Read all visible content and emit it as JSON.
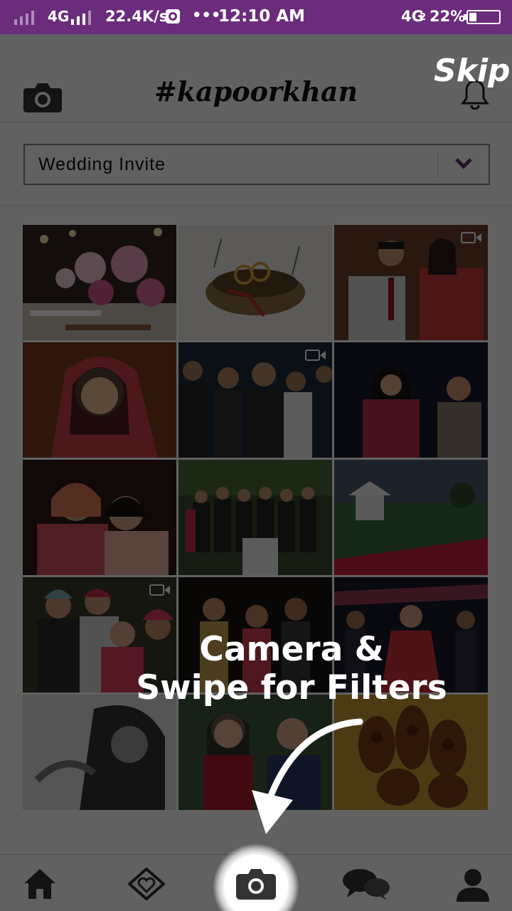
{
  "status_bar": {
    "network": "4G",
    "speed": "22.4K/s",
    "dots": "•••",
    "time": "12:10 AM",
    "network2": "4G",
    "network2_sub": "2",
    "battery": "22%"
  },
  "header": {
    "brand": "#kapoorkhan",
    "camera_icon": "camera-icon",
    "bell_icon": "bell-icon"
  },
  "album_select": {
    "selected": "Wedding Invite",
    "chevron_icon": "chevron-down-icon",
    "accent": "#6b2c7c"
  },
  "gallery": {
    "tiles": [
      {
        "subject": "floral table decor",
        "video": false
      },
      {
        "subject": "rings in nest",
        "video": false
      },
      {
        "subject": "couple seated",
        "video": true
      },
      {
        "subject": "bride portrait",
        "video": false
      },
      {
        "subject": "dance party",
        "video": true
      },
      {
        "subject": "bride dancing",
        "video": false
      },
      {
        "subject": "bride kiss",
        "video": false
      },
      {
        "subject": "group photo",
        "video": false
      },
      {
        "subject": "outdoor venue",
        "video": false
      },
      {
        "subject": "turban family",
        "video": true
      },
      {
        "subject": "night party",
        "video": false
      },
      {
        "subject": "ceremony",
        "video": false
      },
      {
        "subject": "black white portrait",
        "video": false
      },
      {
        "subject": "laughing women",
        "video": false
      },
      {
        "subject": "mehndi hands",
        "video": false
      }
    ]
  },
  "bottom_nav": {
    "items": [
      "home-icon",
      "heart-diamond-icon",
      "camera-icon",
      "chat-icon",
      "profile-icon"
    ]
  },
  "coach_overlay": {
    "skip": "Skip",
    "tip_line1": "Camera &",
    "tip_line2": "Swipe for Filters"
  }
}
